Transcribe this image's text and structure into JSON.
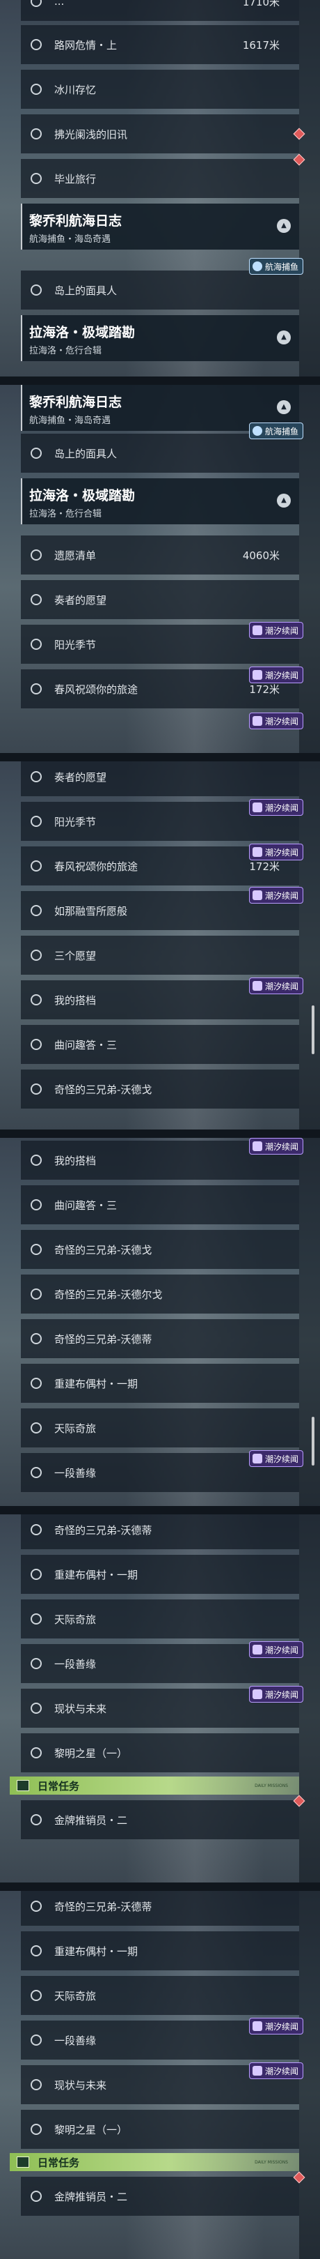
{
  "segments": [
    {
      "items": [
        {
          "label": "...",
          "dist": "1710米"
        },
        {
          "label": "路网危情・上",
          "dist": "1617米"
        },
        {
          "label": "冰川存忆",
          "dist": ""
        },
        {
          "label": "拂光阑浅的旧讯",
          "dist": ""
        },
        {
          "label": "毕业旅行",
          "dist": ""
        }
      ],
      "header1": {
        "title": "黎乔利航海日志",
        "subtitle": "航海捕鱼・海岛奇遇"
      },
      "badge1": "航海捕鱼",
      "item_after_h1": "岛上的面具人",
      "header2": {
        "title": "拉海洛・极域踏勘",
        "subtitle": "拉海洛・危行合辑"
      }
    },
    {
      "header1": {
        "title": "黎乔利航海日志",
        "subtitle": "航海捕鱼・海岛奇遇"
      },
      "badge1": "航海捕鱼",
      "item_after_h1": "岛上的面具人",
      "header2": {
        "title": "拉海洛・极域踏勘",
        "subtitle": "拉海洛・危行合辑"
      },
      "items": [
        {
          "label": "遗愿清单",
          "dist": "4060米"
        },
        {
          "label": "奏者的愿望",
          "dist": ""
        },
        {
          "label": "阳光季节",
          "dist": ""
        },
        {
          "label": "春风祝颂你的旅途",
          "dist": "172米"
        }
      ],
      "badges": [
        "潮汐续闻",
        "潮汐续闻",
        "潮汐续闻"
      ]
    },
    {
      "items": [
        {
          "label": "奏者的愿望",
          "dist": ""
        },
        {
          "label": "阳光季节",
          "dist": ""
        },
        {
          "label": "春风祝颂你的旅途",
          "dist": "172米"
        },
        {
          "label": "如那融雪所愿般",
          "dist": ""
        },
        {
          "label": "三个愿望",
          "dist": ""
        },
        {
          "label": "我的搭档",
          "dist": ""
        },
        {
          "label": "曲问趣答・三",
          "dist": ""
        },
        {
          "label": "奇怪的三兄弟-沃德戈",
          "dist": ""
        }
      ],
      "badges": [
        "潮汐续闻",
        "潮汐续闻",
        "潮汐续闻",
        "潮汐续闻"
      ]
    },
    {
      "items": [
        {
          "label": "我的搭档",
          "dist": ""
        },
        {
          "label": "曲问趣答・三",
          "dist": ""
        },
        {
          "label": "奇怪的三兄弟-沃德戈",
          "dist": ""
        },
        {
          "label": "奇怪的三兄弟-沃德尔戈",
          "dist": ""
        },
        {
          "label": "奇怪的三兄弟-沃德蒂",
          "dist": ""
        },
        {
          "label": "重建布偶村・一期",
          "dist": ""
        },
        {
          "label": "天际奇旅",
          "dist": ""
        },
        {
          "label": "一段善缘",
          "dist": ""
        }
      ],
      "badges": [
        "潮汐续闻",
        "潮汐续闻"
      ]
    },
    {
      "items": [
        {
          "label": "奇怪的三兄弟-沃德蒂",
          "dist": ""
        },
        {
          "label": "重建布偶村・一期",
          "dist": ""
        },
        {
          "label": "天际奇旅",
          "dist": ""
        },
        {
          "label": "一段善缘",
          "dist": ""
        },
        {
          "label": "现状与未来",
          "dist": ""
        },
        {
          "label": "黎明之星（一）",
          "dist": ""
        }
      ],
      "daily": {
        "label": "日常任务",
        "tag": "DAILY MISSIONS"
      },
      "daily_item": "金牌推销员・二",
      "badges": [
        "潮汐续闻",
        "潮汐续闻"
      ]
    },
    {
      "items": [
        {
          "label": "奇怪的三兄弟-沃德蒂",
          "dist": ""
        },
        {
          "label": "重建布偶村・一期",
          "dist": ""
        },
        {
          "label": "天际奇旅",
          "dist": ""
        },
        {
          "label": "一段善缘",
          "dist": ""
        },
        {
          "label": "现状与未来",
          "dist": ""
        },
        {
          "label": "黎明之星（一）",
          "dist": ""
        }
      ],
      "daily": {
        "label": "日常任务",
        "tag": "DAILY MISSIONS"
      },
      "daily_item": "金牌推销员・二",
      "badges": [
        "潮汐续闻",
        "潮汐续闻"
      ]
    }
  ]
}
